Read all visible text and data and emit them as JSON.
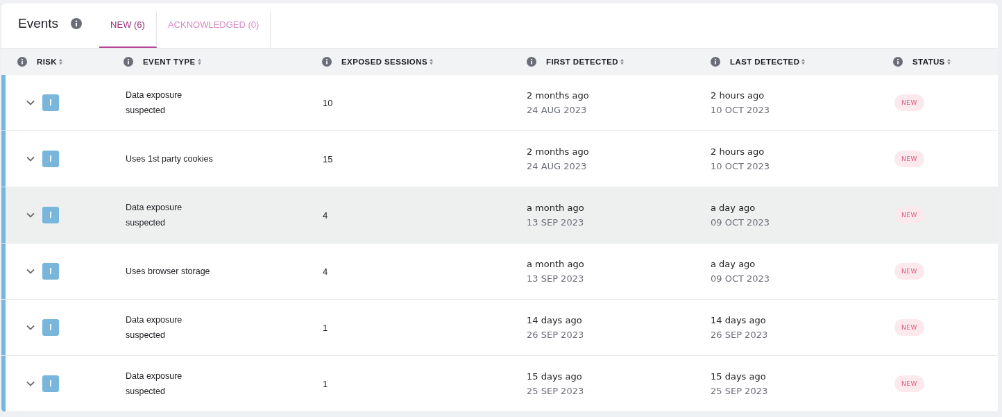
{
  "header": {
    "title": "Events"
  },
  "tabs": [
    {
      "label": "NEW (6)",
      "selected": true
    },
    {
      "label": "ACKNOWLEDGED (0)",
      "selected": false
    }
  ],
  "table": {
    "columns": [
      "RISK",
      "EVENT TYPE",
      "EXPOSED SESSIONS",
      "FIRST DETECTED",
      "LAST DETECTED",
      "STATUS"
    ],
    "rows": [
      {
        "risk": "I",
        "color": "#78b6db",
        "event_type": "Data exposure suspected",
        "exposed_sessions": "10",
        "first_relative": "2 months ago",
        "first_date": "24 AUG 2023",
        "last_relative": "2 hours ago",
        "last_date": "10 OCT 2023",
        "status": "NEW",
        "highlighted": false
      },
      {
        "risk": "I",
        "color": "#78b6db",
        "event_type": "Uses 1st party cookies",
        "exposed_sessions": "15",
        "first_relative": "2 months ago",
        "first_date": "24 AUG 2023",
        "last_relative": "2 hours ago",
        "last_date": "10 OCT 2023",
        "status": "NEW",
        "highlighted": false
      },
      {
        "risk": "I",
        "color": "#78b6db",
        "event_type": "Data exposure suspected",
        "exposed_sessions": "4",
        "first_relative": "a month ago",
        "first_date": "13 SEP 2023",
        "last_relative": "a day ago",
        "last_date": "09 OCT 2023",
        "status": "NEW",
        "highlighted": true
      },
      {
        "risk": "I",
        "color": "#78b6db",
        "event_type": "Uses browser storage",
        "exposed_sessions": "4",
        "first_relative": "a month ago",
        "first_date": "13 SEP 2023",
        "last_relative": "a day ago",
        "last_date": "09 OCT 2023",
        "status": "NEW",
        "highlighted": false
      },
      {
        "risk": "I",
        "color": "#78b6db",
        "event_type": "Data exposure suspected",
        "exposed_sessions": "1",
        "first_relative": "14 days ago",
        "first_date": "26 SEP 2023",
        "last_relative": "14 days ago",
        "last_date": "26 SEP 2023",
        "status": "NEW",
        "highlighted": false
      },
      {
        "risk": "I",
        "color": "#78b6db",
        "event_type": "Data exposure suspected",
        "exposed_sessions": "1",
        "first_relative": "15 days ago",
        "first_date": "25 SEP 2023",
        "last_relative": "15 days ago",
        "last_date": "25 SEP 2023",
        "status": "NEW",
        "highlighted": false
      }
    ]
  }
}
